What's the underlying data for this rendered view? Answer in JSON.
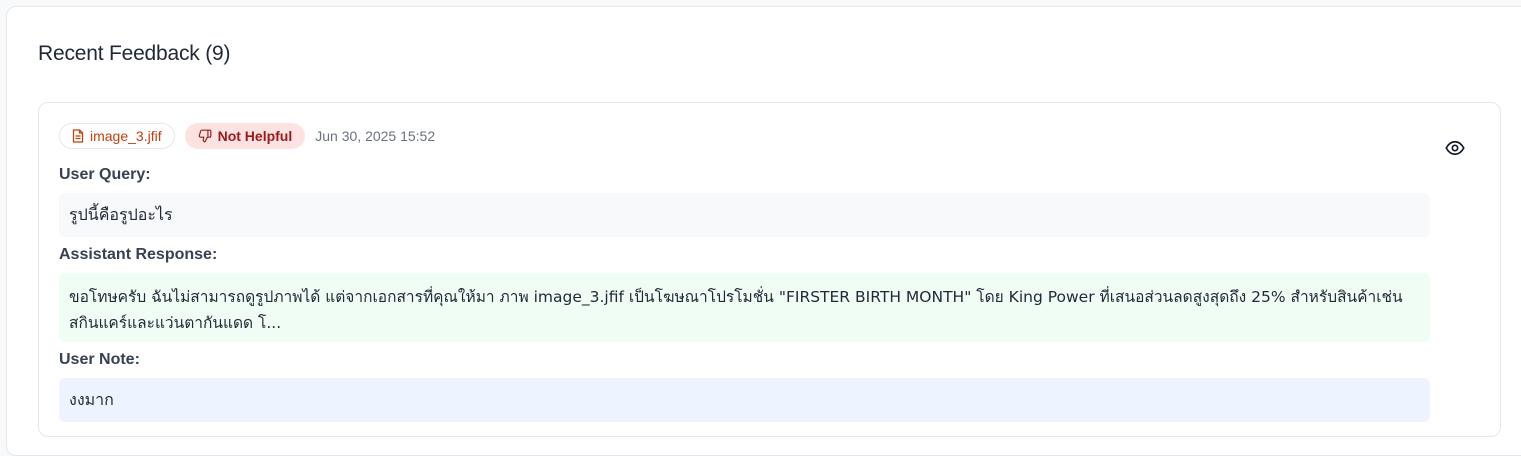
{
  "header": {
    "title": "Recent Feedback (9)"
  },
  "feedback": {
    "file_name": "image_3.jfif",
    "rating_label": "Not Helpful",
    "timestamp": "Jun 30, 2025 15:52",
    "user_query_label": "User Query:",
    "user_query": "รูปนี้คือรูปอะไร",
    "assistant_response_label": "Assistant Response:",
    "assistant_response": "ขอโทษครับ ฉันไม่สามารถดูรูปภาพได้ แต่จากเอกสารที่คุณให้มา ภาพ image_3.jfif เป็นโฆษณาโปรโมชั่น \"FIRSTER BIRTH MONTH\" โดย King Power ที่เสนอส่วนลดสูงสุดถึง 25% สำหรับสินค้าเช่น สกินแคร์และแว่นตากันแดด โ...",
    "user_note_label": "User Note:",
    "user_note": "งงมาก"
  },
  "icons": {
    "file": "file-icon",
    "rating": "thumbs-down-icon",
    "view": "eye-icon"
  },
  "colors": {
    "file_chip_text": "#c2410c",
    "rating_chip_bg": "#fde2e2",
    "rating_chip_text": "#991b1b",
    "response_bg": "#f0fdf4",
    "note_bg": "#eef4ff",
    "query_bg": "#f8f9fa"
  }
}
